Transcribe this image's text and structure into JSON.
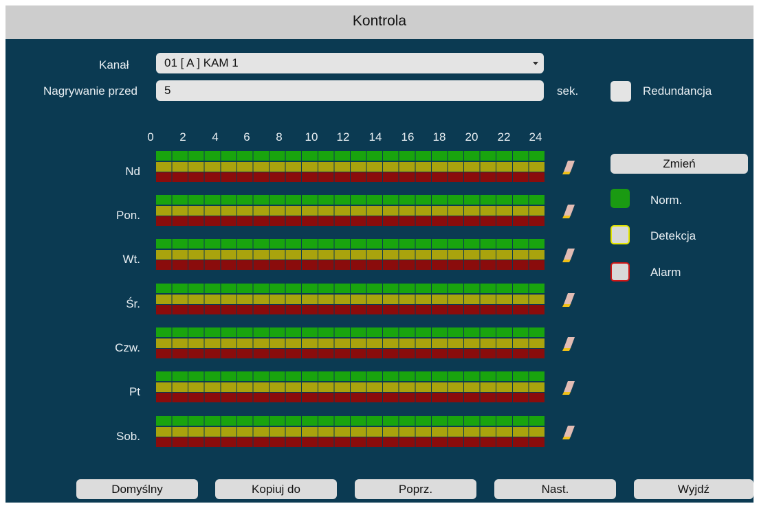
{
  "window": {
    "title": "Kontrola"
  },
  "kanal": {
    "label": "Kanał",
    "value": "01 [ A ] KAM 1"
  },
  "prerecord": {
    "label": "Nagrywanie przed",
    "value": "5",
    "unit": "sek."
  },
  "redundancy": {
    "label": "Redundancja",
    "checked": false
  },
  "hours": [
    "0",
    "2",
    "4",
    "6",
    "8",
    "10",
    "12",
    "14",
    "16",
    "18",
    "20",
    "22",
    "24"
  ],
  "days": [
    "Nd",
    "Pon.",
    "Wt.",
    "Śr.",
    "Czw.",
    "Pt",
    "Sob."
  ],
  "schedule": {
    "bands": [
      {
        "type": "Norm.",
        "color": "#19a40e",
        "hours_active": [
          0,
          24
        ]
      },
      {
        "type": "Detekcja",
        "color": "#a9a30d",
        "hours_active": [
          0,
          24
        ]
      },
      {
        "type": "Alarm",
        "color": "#8a0c0c",
        "hours_active": [
          0,
          24
        ]
      }
    ]
  },
  "side": {
    "change_label": "Zmień",
    "legend": [
      {
        "label": "Norm.",
        "fill": "#1a9a12",
        "border": "#1a9a12"
      },
      {
        "label": "Detekcja",
        "fill": "#d8d8d8",
        "border": "#e6e600"
      },
      {
        "label": "Alarm",
        "fill": "#d8d8d8",
        "border": "#d01515"
      }
    ]
  },
  "footer": {
    "default_label": "Domyślny",
    "copy_label": "Kopiuj do",
    "prev_label": "Poprz.",
    "next_label": "Nast.",
    "exit_label": "Wyjdź"
  },
  "icons": {
    "row_action": "eraser-icon",
    "dropdown": "caret-down-icon"
  }
}
